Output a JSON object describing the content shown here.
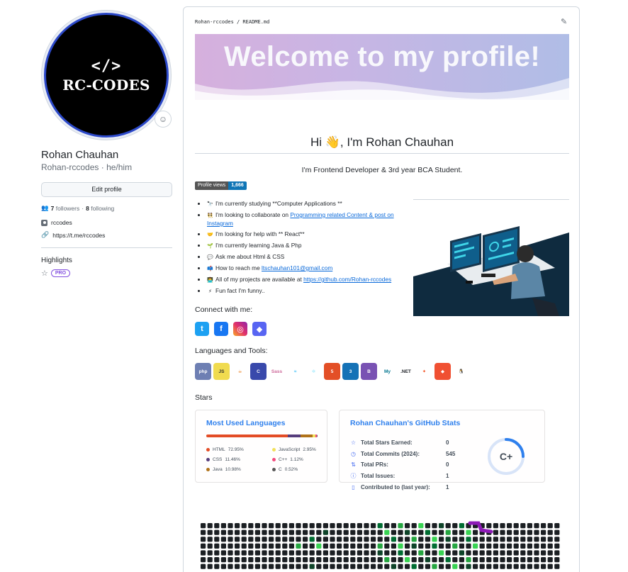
{
  "profile": {
    "avatar_code": "</>",
    "avatar_text": "RC-CODES",
    "fullname": "Rohan Chauhan",
    "login": "Rohan-rccodes",
    "pronouns": "he/him",
    "edit_button": "Edit profile",
    "followers_count": "7",
    "followers_label": "followers",
    "following_count": "8",
    "following_label": "following",
    "org": "rccodes",
    "website": "https://t.me/rccodes",
    "highlights_title": "Highlights",
    "pro_badge": "PRO"
  },
  "readme": {
    "path": "Rohan-rccodes / README.md",
    "banner_title": "Welcome to my profile!",
    "hi_title": "Hi 👋, I'm Rohan Chauhan",
    "tagline": "I'm Frontend Developer & 3rd year BCA Student.",
    "views_label": "Profile views",
    "views_value": "1,666",
    "facts": [
      {
        "icon": "🔭",
        "text": "I'm currently studying **Computer Applications **"
      },
      {
        "icon": "👯",
        "text": "I'm looking to collaborate on ",
        "link": "Programming related Content & post on Instagram"
      },
      {
        "icon": "🤝",
        "text": "I'm looking for help with ** React**"
      },
      {
        "icon": "🌱",
        "text": "I'm currently learning Java & Php"
      },
      {
        "icon": "💬",
        "text": "Ask me about Html & CSS"
      },
      {
        "icon": "📫",
        "text": "How to reach me ",
        "link": "ltschauhan101@gmail.com"
      },
      {
        "icon": "👨‍💻",
        "text": "All of my projects are available at ",
        "link": "https://github.com/Rohan-rccodes"
      },
      {
        "icon": "⚡",
        "text": "Fun fact I'm funny.."
      }
    ],
    "connect_title": "Connect with me:",
    "social": [
      {
        "icon": "twitter-icon",
        "glyph": "t",
        "color": "#1da1f2"
      },
      {
        "icon": "facebook-icon",
        "glyph": "f",
        "color": "#1877f2"
      },
      {
        "icon": "instagram-icon",
        "glyph": "◎",
        "color": "#e1306c"
      },
      {
        "icon": "discord-icon",
        "glyph": "◆",
        "color": "#5865f2"
      }
    ],
    "tools_title": "Languages and Tools:",
    "tools": [
      {
        "icon": "php-icon",
        "glyph": "php",
        "bg": "#6e7fb3",
        "fg": "#ffffff"
      },
      {
        "icon": "javascript-icon",
        "glyph": "JS",
        "bg": "#f0db4f",
        "fg": "#323330"
      },
      {
        "icon": "java-icon",
        "glyph": "☕",
        "bg": "#ffffff",
        "fg": "#e76f00"
      },
      {
        "icon": "c-icon",
        "glyph": "C",
        "bg": "#3949ab",
        "fg": "#ffffff"
      },
      {
        "icon": "sass-icon",
        "glyph": "Sass",
        "bg": "#ffffff",
        "fg": "#cd6799"
      },
      {
        "icon": "tailwind-icon",
        "glyph": "≈",
        "bg": "#ffffff",
        "fg": "#38bdf8"
      },
      {
        "icon": "react-icon",
        "glyph": "⚛",
        "bg": "#ffffff",
        "fg": "#61dafb"
      },
      {
        "icon": "html5-icon",
        "glyph": "5",
        "bg": "#e34f26",
        "fg": "#ffffff"
      },
      {
        "icon": "css3-icon",
        "glyph": "3",
        "bg": "#1572b6",
        "fg": "#ffffff"
      },
      {
        "icon": "bootstrap-icon",
        "glyph": "B",
        "bg": "#7952b3",
        "fg": "#ffffff"
      },
      {
        "icon": "mysql-icon",
        "glyph": "My",
        "bg": "#ffffff",
        "fg": "#00758f"
      },
      {
        "icon": "dotnet-icon",
        "glyph": ".NET",
        "bg": "#ffffff",
        "fg": "#1f2328"
      },
      {
        "icon": "figma-icon",
        "glyph": "✦",
        "bg": "#ffffff",
        "fg": "#f24e1e"
      },
      {
        "icon": "git-icon",
        "glyph": "◆",
        "bg": "#f05032",
        "fg": "#ffffff"
      },
      {
        "icon": "linux-icon",
        "glyph": "🐧",
        "bg": "#ffffff",
        "fg": "#000000"
      }
    ],
    "stars_title": "Stars"
  },
  "languages_card": {
    "title": "Most Used Languages",
    "items": [
      {
        "name": "HTML",
        "percent": "72.95%",
        "value": 72.95,
        "color": "#e34c26"
      },
      {
        "name": "JavaScript",
        "percent": "2.95%",
        "value": 2.95,
        "color": "#f1e05a"
      },
      {
        "name": "CSS",
        "percent": "11.46%",
        "value": 11.46,
        "color": "#563d7c"
      },
      {
        "name": "C++",
        "percent": "1.12%",
        "value": 1.12,
        "color": "#f34b7d"
      },
      {
        "name": "Java",
        "percent": "10.98%",
        "value": 10.98,
        "color": "#b07219"
      },
      {
        "name": "C",
        "percent": "0.52%",
        "value": 0.52,
        "color": "#555555"
      }
    ]
  },
  "stats_card": {
    "title": "Rohan Chauhan's GitHub Stats",
    "rows": [
      {
        "icon": "star-icon",
        "glyph": "☆",
        "label": "Total Stars Earned:",
        "value": "0"
      },
      {
        "icon": "clock-icon",
        "glyph": "◷",
        "label": "Total Commits (2024):",
        "value": "545"
      },
      {
        "icon": "pull-request-icon",
        "glyph": "⇅",
        "label": "Total PRs:",
        "value": "0"
      },
      {
        "icon": "issue-icon",
        "glyph": "ⓘ",
        "label": "Total Issues:",
        "value": "1"
      },
      {
        "icon": "repo-icon",
        "glyph": "▯",
        "label": "Contributed to (last year):",
        "value": "1"
      }
    ],
    "grade": "C+",
    "grade_progress": 0.25,
    "accent": "#2f80ed"
  }
}
